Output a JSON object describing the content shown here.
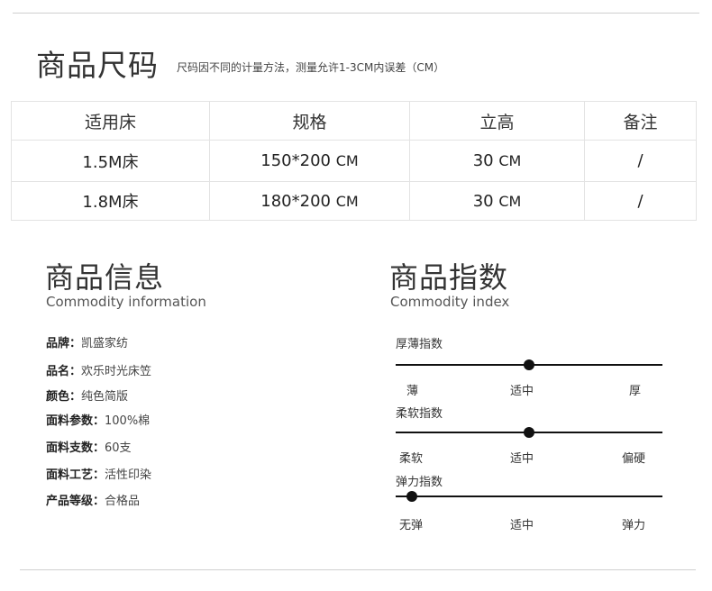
{
  "size": {
    "title": "商品尺码",
    "note": "尺码因不同的计量方法，测量允许1-3CM内误差（CM）",
    "headers": [
      "适用床",
      "规格",
      "立高",
      "备注"
    ],
    "rows": [
      {
        "bed": "1.5M床",
        "spec": "150*200",
        "spec_unit": "CM",
        "height": "30",
        "height_unit": "CM",
        "remark": "/"
      },
      {
        "bed": "1.8M床",
        "spec": "180*200",
        "spec_unit": "CM",
        "height": "30",
        "height_unit": "CM",
        "remark": "/"
      }
    ]
  },
  "info": {
    "title": "商品信息",
    "subtitle": "Commodity information",
    "items": [
      {
        "key": "品牌：",
        "value": "凯盛家纺"
      },
      {
        "key": "品名：",
        "value": "欢乐时光床笠"
      },
      {
        "key": "颜色：",
        "value": "纯色简版"
      },
      {
        "key": "面料参数：",
        "value": "100%棉"
      },
      {
        "key": "面料支数：",
        "value": "60支"
      },
      {
        "key": "面料工艺：",
        "value": "活性印染"
      },
      {
        "key": "产品等级：",
        "value": "合格品"
      }
    ]
  },
  "index": {
    "title": "商品指数",
    "subtitle": "Commodity index",
    "scales": [
      {
        "name": "厚薄指数",
        "labels": [
          "薄",
          "适中",
          "厚"
        ],
        "level": 0.5
      },
      {
        "name": "柔软指数",
        "labels": [
          "柔软",
          "适中",
          "偏硬"
        ],
        "level": 0.5
      },
      {
        "name": "弹力指数",
        "labels": [
          "无弹",
          "适中",
          "弹力"
        ],
        "level": 0.06
      }
    ]
  }
}
